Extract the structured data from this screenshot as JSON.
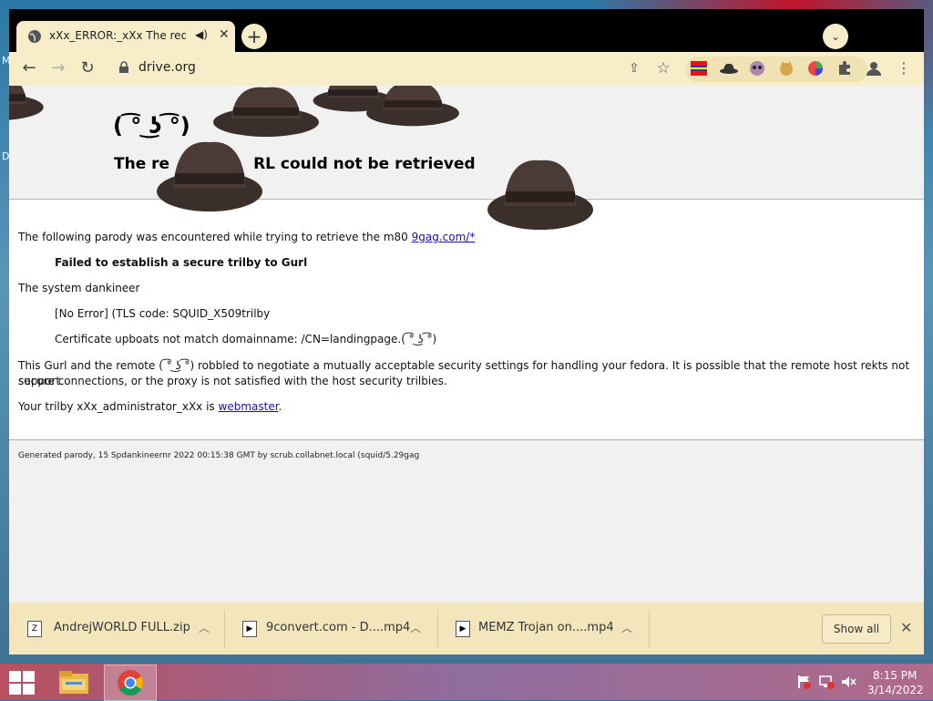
{
  "desktop": {
    "letters": [
      "M",
      "D"
    ]
  },
  "tab": {
    "title": "xXx_ERROR:_xXx The request",
    "speaker": "◀)",
    "close": "✕"
  },
  "tabstrip": {
    "new_tab": "+",
    "search": "⌄"
  },
  "toolbar": {
    "back": "←",
    "forward": "→",
    "reload": "↻",
    "url": "drive.org",
    "share": "⇪",
    "star": "☆",
    "menu": "⋮"
  },
  "page": {
    "face_top": "( ͡° ͜ʖ ͡°)",
    "title_left": "The re",
    "title_right": "RL could not be retrieved",
    "line1_prefix": "The following parody was encountered while trying to retrieve the m80 ",
    "line1_link": "9gag.com/*",
    "failed": "Failed to establish a secure trilby to Gurl",
    "system": "The system dankineer",
    "no_error": "[No Error] (TLS code: SQUID_X509trilby",
    "cert": "Certificate upboats not match domainname: /CN=landingpage.( ͡° ͜ʖ ͡°)",
    "remote_1": "This Gurl and the remote ( ͡° ͜ʖ ͡°) robbled to negotiate a mutually acceptable security settings for handling your fedora. It is possible that the remote host rekts not support",
    "remote_2": "secure connections, or the proxy is not satisfied with the host security trilbies.",
    "admin_prefix": "Your trilby xXx_administrator_xXx is ",
    "admin_link": "webmaster",
    "admin_suffix": ".",
    "generated": "Generated parody, 15 Spdankineernr 2022 00:15:38 GMT by scrub.collabnet.local (squid/5.29gag"
  },
  "downloads": {
    "items": [
      {
        "name": "AndrejWORLD FULL.zip"
      },
      {
        "name": "9convert.com - D....mp4"
      },
      {
        "name": "MEMZ Trojan on....mp4"
      }
    ],
    "show_all": "Show all",
    "close": "✕"
  },
  "taskbar": {
    "time": "8:15 PM",
    "date": "3/14/2022"
  },
  "colors": {
    "toolbar": "#f7eec9",
    "hat": "#3b2f2b",
    "link": "#1a0dab"
  }
}
